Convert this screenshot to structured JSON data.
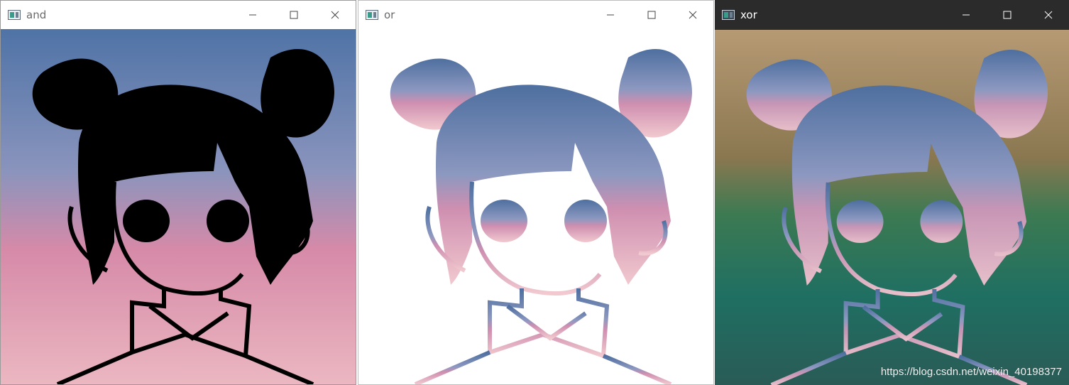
{
  "windows": [
    {
      "title": "and",
      "bar_bg": "#ffffff",
      "title_color": "#6a6a6a"
    },
    {
      "title": "or",
      "bar_bg": "#ffffff",
      "title_color": "#6a6a6a"
    },
    {
      "title": "xor",
      "bar_bg": "#2b2b2b",
      "title_color": "#ffffff"
    }
  ],
  "watermark": "https://blog.csdn.net/weixin_40198377",
  "icons": {
    "app": "opencv-window-icon",
    "minimize": "minimize-icon",
    "maximize": "maximize-icon",
    "close": "close-icon"
  },
  "colors": {
    "sky_top": "#4f73a6",
    "sky_mid": "#8f8fb8",
    "sky_pink": "#d68aa8",
    "sky_bottom": "#e9b8c2",
    "xor_top": "#b69a74",
    "xor_mid": "#6a6a44",
    "xor_green": "#1f7a64"
  }
}
